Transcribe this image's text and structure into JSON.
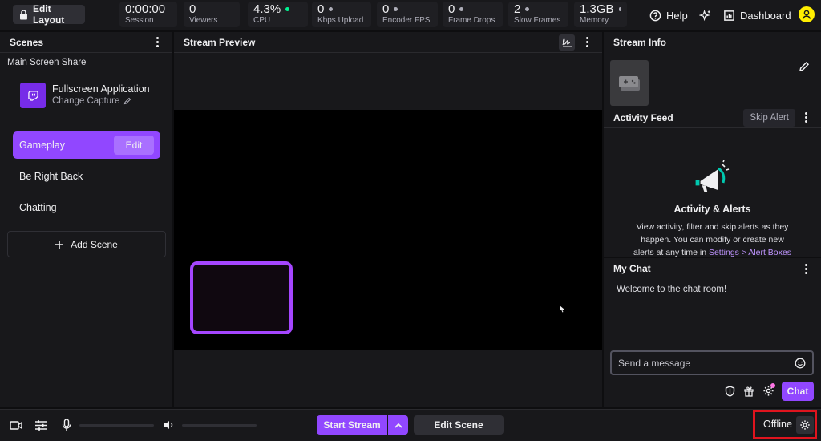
{
  "topbar": {
    "edit_layout": "Edit Layout",
    "stats": [
      {
        "value": "0:00:00",
        "label": "Session",
        "dot": ""
      },
      {
        "value": "0",
        "label": "Viewers",
        "dot": ""
      },
      {
        "value": "4.3%",
        "label": "CPU",
        "dot": "green"
      },
      {
        "value": "0",
        "label": "Kbps Upload",
        "dot": "grey"
      },
      {
        "value": "0",
        "label": "Encoder FPS",
        "dot": "grey"
      },
      {
        "value": "0",
        "label": "Frame Drops",
        "dot": "grey"
      },
      {
        "value": "2",
        "label": "Slow Frames",
        "dot": "grey"
      },
      {
        "value": "1.3GB",
        "label": "Memory",
        "dot": "grey"
      }
    ],
    "help": "Help",
    "dashboard": "Dashboard"
  },
  "scenes": {
    "title": "Scenes",
    "group": "Main Screen Share",
    "source_title": "Fullscreen Application",
    "source_sub": "Change Capture",
    "items": [
      "Gameplay",
      "Be Right Back",
      "Chatting"
    ],
    "edit_label": "Edit",
    "add_scene": "Add Scene"
  },
  "preview": {
    "title": "Stream Preview"
  },
  "stream_info": {
    "title": "Stream Info"
  },
  "activity": {
    "title": "Activity Feed",
    "skip": "Skip Alert",
    "heading": "Activity & Alerts",
    "desc1": "View activity, filter and skip alerts as they",
    "desc2": "happen. You can modify or create new",
    "desc3": "alerts at any time in",
    "link": "Settings > Alert Boxes"
  },
  "chat": {
    "title": "My Chat",
    "welcome": "Welcome to the chat room!",
    "placeholder": "Send a message",
    "chat_btn": "Chat"
  },
  "bottombar": {
    "start_stream": "Start Stream",
    "edit_scene": "Edit Scene",
    "status": "Offline"
  },
  "colors": {
    "accent": "#9147ff",
    "highlight_box": "#e0141e"
  }
}
